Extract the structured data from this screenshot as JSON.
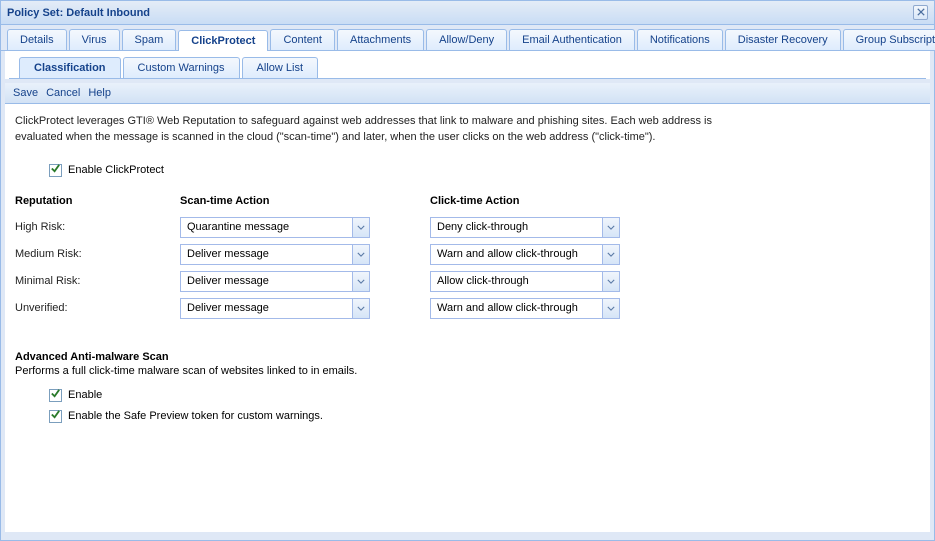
{
  "window": {
    "title": "Policy Set: Default Inbound"
  },
  "tabs": {
    "items": [
      {
        "label": "Details"
      },
      {
        "label": "Virus"
      },
      {
        "label": "Spam"
      },
      {
        "label": "ClickProtect"
      },
      {
        "label": "Content"
      },
      {
        "label": "Attachments"
      },
      {
        "label": "Allow/Deny"
      },
      {
        "label": "Email Authentication"
      },
      {
        "label": "Notifications"
      },
      {
        "label": "Disaster Recovery"
      },
      {
        "label": "Group Subscriptions"
      }
    ]
  },
  "subtabs": {
    "items": [
      {
        "label": "Classification"
      },
      {
        "label": "Custom Warnings"
      },
      {
        "label": "Allow List"
      }
    ]
  },
  "toolbar": {
    "save": "Save",
    "cancel": "Cancel",
    "help": "Help"
  },
  "description": "ClickProtect leverages GTI® Web Reputation to safeguard against web addresses that link to malware and phishing sites. Each web address is evaluated when the message is scanned in the cloud (\"scan-time\") and later, when the user clicks on the web address (\"click-time\").",
  "enable_clickprotect_label": "Enable ClickProtect",
  "grid": {
    "headers": {
      "reputation": "Reputation",
      "scan": "Scan-time Action",
      "click": "Click-time Action"
    },
    "rows": [
      {
        "rep": "High Risk:",
        "scan": "Quarantine message",
        "click": "Deny click-through"
      },
      {
        "rep": "Medium Risk:",
        "scan": "Deliver message",
        "click": "Warn and allow click-through"
      },
      {
        "rep": "Minimal Risk:",
        "scan": "Deliver message",
        "click": "Allow click-through"
      },
      {
        "rep": "Unverified:",
        "scan": "Deliver message",
        "click": "Warn and allow click-through"
      }
    ]
  },
  "advanced": {
    "header": "Advanced Anti-malware Scan",
    "desc": "Performs a full click-time malware scan of websites linked to in emails.",
    "enable_label": "Enable",
    "safe_preview_label": "Enable the Safe Preview token for custom warnings."
  }
}
